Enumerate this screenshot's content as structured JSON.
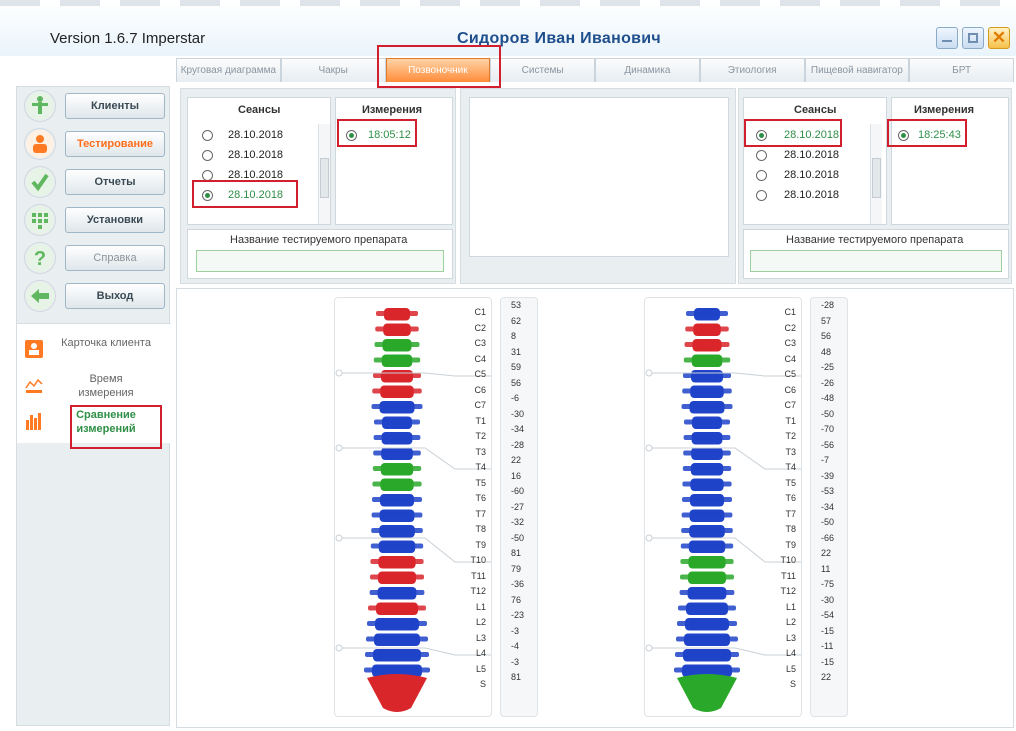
{
  "app": {
    "version": "Version 1.6.7 Imperstar",
    "patient_name": "Сидоров Иван Иванович"
  },
  "window_buttons": {
    "minimize": "minimize-icon",
    "maximize": "maximize-icon",
    "close": "close-icon"
  },
  "tabs": [
    {
      "label": "Круговая диаграмма",
      "active": false
    },
    {
      "label": "Чакры",
      "active": false
    },
    {
      "label": "Позвоночник",
      "active": true
    },
    {
      "label": "Системы",
      "active": false
    },
    {
      "label": "Динамика",
      "active": false
    },
    {
      "label": "Этиология",
      "active": false
    },
    {
      "label": "Пищевой навигатор",
      "active": false
    },
    {
      "label": "БРТ",
      "active": false
    }
  ],
  "sidebar": {
    "nav": [
      {
        "label": "Клиенты",
        "icon": "person-icon",
        "color": "#5fb85f",
        "active": false
      },
      {
        "label": "Тестирование",
        "icon": "user-icon",
        "color": "#ff6d1b",
        "active": true
      },
      {
        "label": "Отчеты",
        "icon": "checkmark-icon",
        "color": "#5fb85f",
        "active": false
      },
      {
        "label": "Установки",
        "icon": "dots-grid-icon",
        "color": "#5fb85f",
        "active": false
      },
      {
        "label": "Справка",
        "icon": "question-icon",
        "color": "#5fb85f",
        "active": false
      },
      {
        "label": "Выход",
        "icon": "arrow-left-icon",
        "color": "#5fb85f",
        "active": false
      }
    ],
    "sub": [
      {
        "label": "Карточка клиента",
        "icon": "card-icon",
        "active": false
      },
      {
        "label": "Время измерения",
        "icon": "line-chart-icon",
        "active": false
      },
      {
        "label": "Сравнение измерений",
        "icon": "bar-chart-icon",
        "active": true
      }
    ]
  },
  "left_panel": {
    "sessions_header": "Сеансы",
    "measurements_header": "Измерения",
    "sessions": [
      {
        "date": "28.10.2018",
        "selected": false
      },
      {
        "date": "28.10.2018",
        "selected": false
      },
      {
        "date": "28.10.2018",
        "selected": false
      },
      {
        "date": "28.10.2018",
        "selected": true
      }
    ],
    "measurements": [
      {
        "time": "18:05:12",
        "selected": true
      }
    ],
    "preparation_label": "Название тестируемого препарата",
    "preparation_value": ""
  },
  "right_panel": {
    "sessions_header": "Сеансы",
    "measurements_header": "Измерения",
    "sessions": [
      {
        "date": "28.10.2018",
        "selected": true
      },
      {
        "date": "28.10.2018",
        "selected": false
      },
      {
        "date": "28.10.2018",
        "selected": false
      },
      {
        "date": "28.10.2018",
        "selected": false
      }
    ],
    "measurements": [
      {
        "time": "18:25:43",
        "selected": true
      }
    ],
    "preparation_label": "Название тестируемого препарата",
    "preparation_value": ""
  },
  "spine": {
    "segments": [
      "C1",
      "C2",
      "C3",
      "C4",
      "C5",
      "C6",
      "C7",
      "T1",
      "T2",
      "T3",
      "T4",
      "T5",
      "T6",
      "T7",
      "T8",
      "T9",
      "T10",
      "T11",
      "T12",
      "L1",
      "L2",
      "L3",
      "L4",
      "L5",
      "S"
    ],
    "colors": {
      "positive_high": "#d9262b",
      "positive": "#2aa82a",
      "negative": "#1f43c9"
    },
    "left_values": [
      53,
      62,
      8,
      31,
      59,
      56,
      -6,
      -30,
      -34,
      -28,
      22,
      16,
      -60,
      -27,
      -32,
      -50,
      81,
      79,
      -36,
      76,
      -23,
      -3,
      -4,
      -3,
      81
    ],
    "right_values": [
      -28,
      57,
      56,
      48,
      -25,
      -26,
      -48,
      -50,
      -70,
      -56,
      -7,
      -39,
      -53,
      -34,
      -50,
      -66,
      22,
      11,
      -75,
      -30,
      -54,
      -15,
      -11,
      -15,
      22
    ]
  }
}
